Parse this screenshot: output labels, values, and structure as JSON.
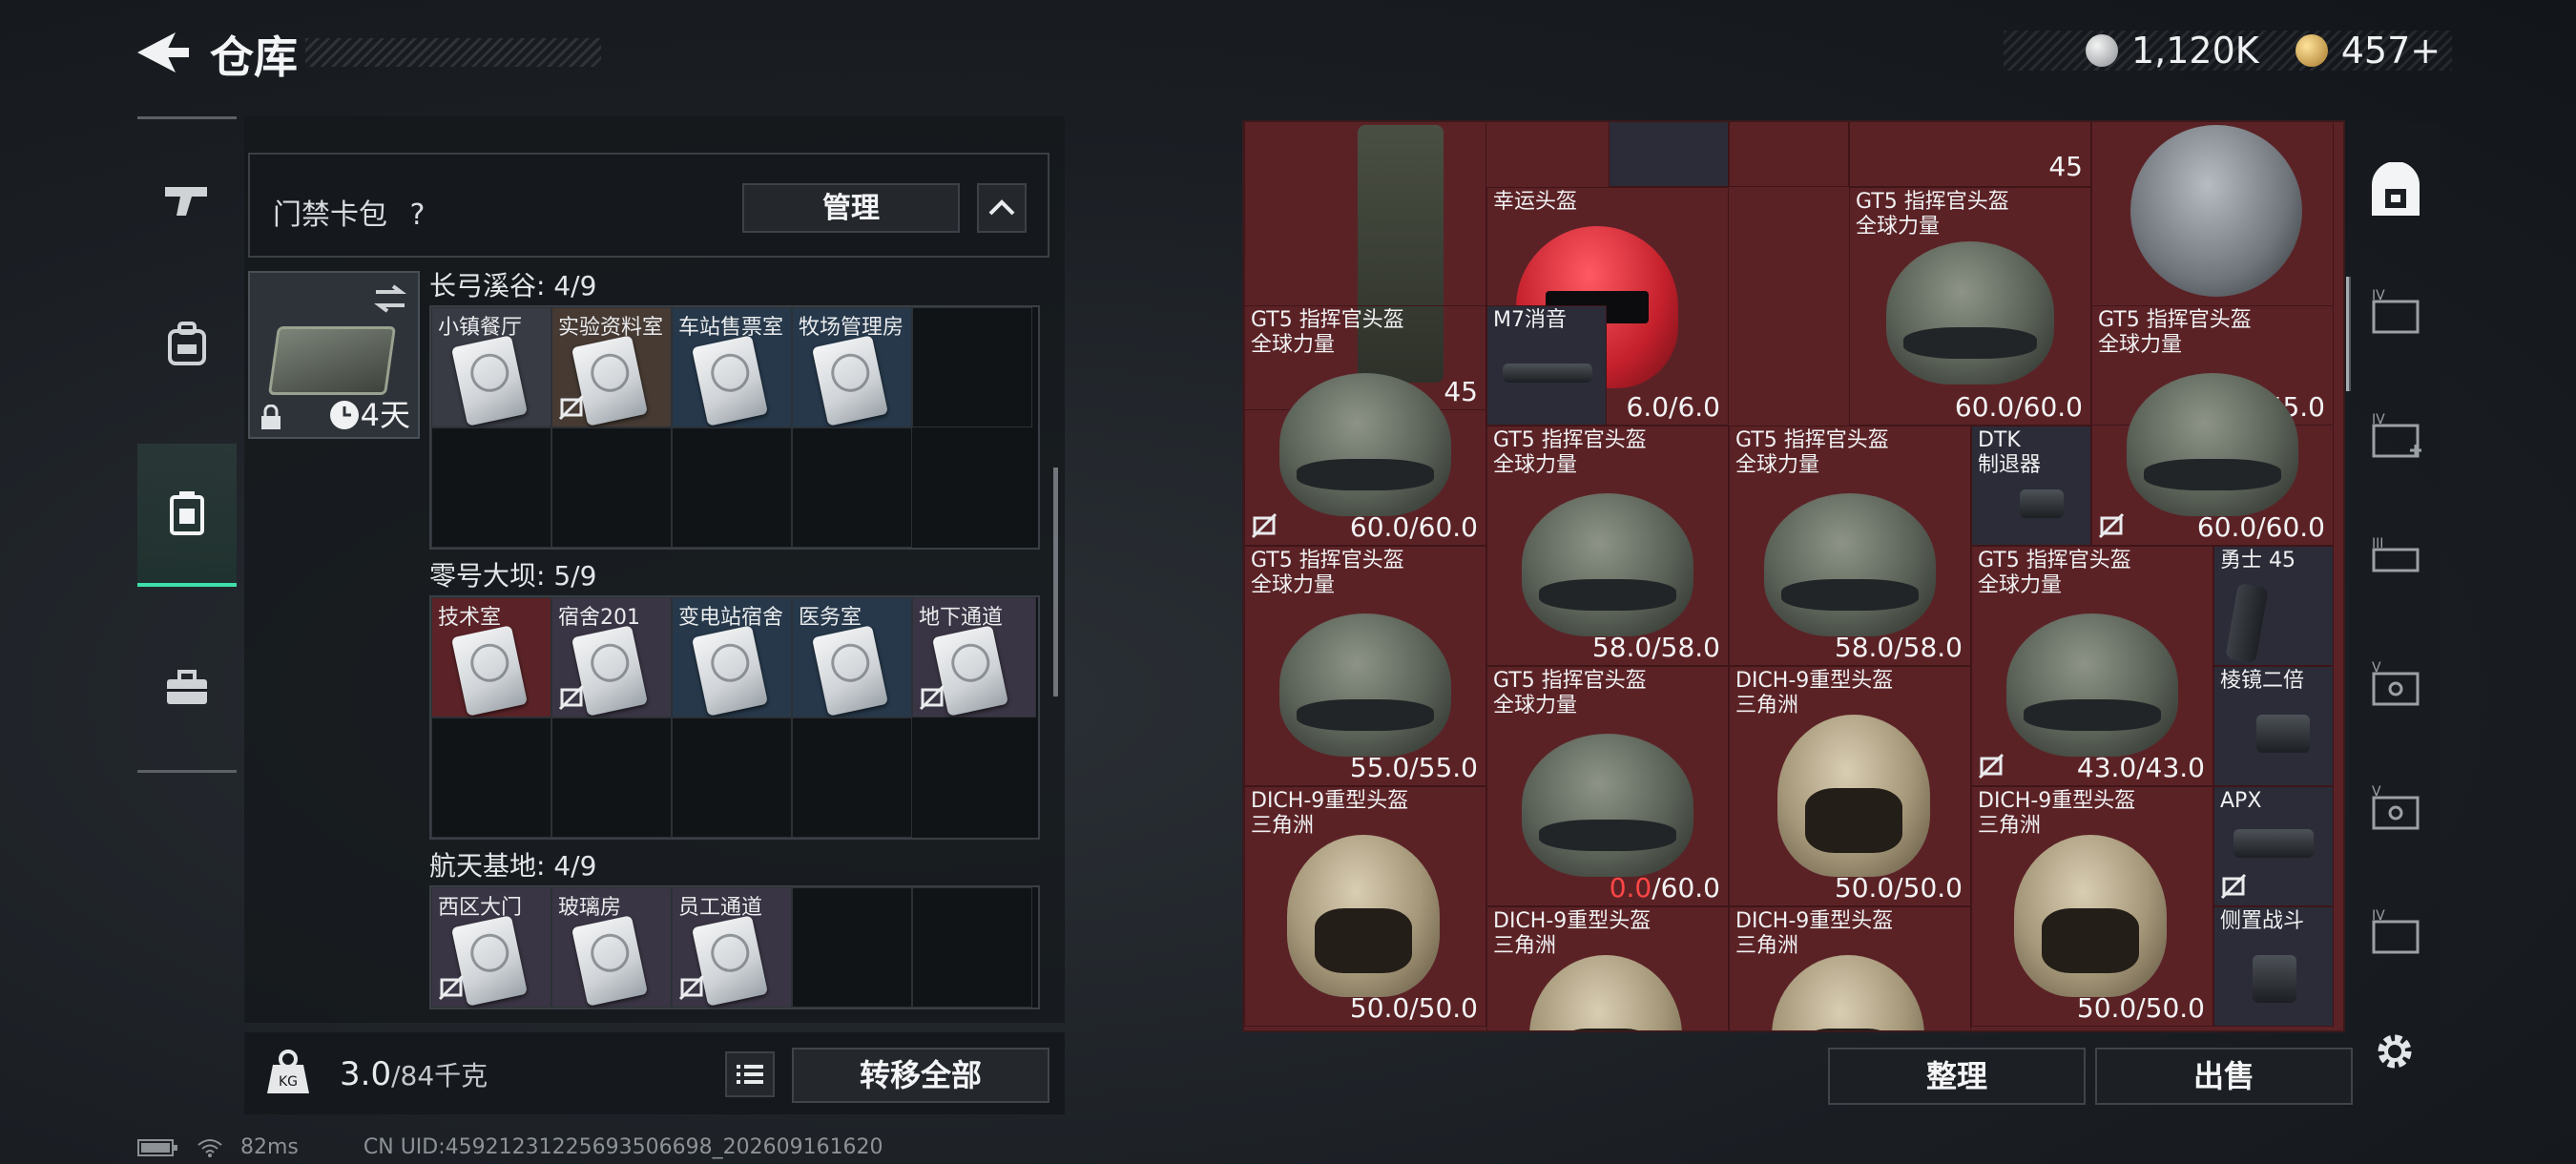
{
  "header": {
    "title": "仓库"
  },
  "currency": {
    "coins": "1,120K",
    "gems": "457+"
  },
  "left_panel": {
    "card_bag_label": "门禁卡包",
    "help": "?",
    "manage_label": "管理",
    "keybag_days": "4天",
    "sections": [
      {
        "title": "长弓溪谷: 4/9",
        "cards": [
          "小镇餐厅",
          "实验资料室",
          "车站售票室",
          "牧场管理房"
        ]
      },
      {
        "title": "零号大坝: 5/9",
        "cards": [
          "技术室",
          "宿舍201",
          "变电站宿舍",
          "医务室",
          "地下通道"
        ]
      },
      {
        "title": "航天基地: 4/9",
        "cards": [
          "西区大门",
          "玻璃房",
          "员工通道"
        ]
      }
    ],
    "weight_value": "3.0",
    "weight_unit": "/84千克",
    "transfer_label": "转移全部"
  },
  "stash": {
    "items": [
      {
        "count": "45"
      },
      {
        "count": "45"
      },
      {
        "name": "幸运头盔",
        "dura": "6.0/6.0"
      },
      {
        "name": "GT5 指挥官头盔\n全球力量",
        "dura": "60.0/60.0"
      },
      {
        "dura": "55.0/55.0"
      },
      {
        "name": "GT5 指挥官头盔\n全球力量",
        "dura": "60.0/60.0"
      },
      {
        "name": "M7消音"
      },
      {
        "name": "GT5 指挥官头盔\n全球力量",
        "dura": "60.0/60.0"
      },
      {
        "name": "GT5 指挥官头盔\n全球力量",
        "dura": "58.0/58.0"
      },
      {
        "name": "GT5 指挥官头盔\n全球力量",
        "dura": "58.0/58.0"
      },
      {
        "name": "DTK\n制退器"
      },
      {
        "name": "GT5 指挥官头盔\n全球力量",
        "dura": "55.0/55.0"
      },
      {
        "name": "GT5 指挥官头盔\n全球力量",
        "dura": "43.0/43.0"
      },
      {
        "name": "勇士 45"
      },
      {
        "name": "GT5 指挥官头盔\n全球力量",
        "dura_bad": "0.0",
        "dura_max": "/60.0"
      },
      {
        "name": "DICH-9重型头盔\n三角洲",
        "dura": "50.0/50.0"
      },
      {
        "name": "棱镜二倍"
      },
      {
        "name": "DICH-9重型头盔\n三角洲",
        "dura": "50.0/50.0"
      },
      {
        "name": "DICH-9重型头盔\n三角洲",
        "dura": "50.0/50.0"
      },
      {
        "name": "APX"
      },
      {
        "name": "DICH-9重型头盔\n三角洲"
      },
      {
        "name": "DICH-9重型头盔\n三角洲"
      },
      {
        "name": "侧置战斗"
      }
    ],
    "sort_label": "整理",
    "sell_label": "出售"
  },
  "status": {
    "ping": "82ms",
    "uid": "CN UID:459212312256935066​98_202609161620"
  },
  "colors": {
    "accent": "#3fe0a9",
    "stash_bg": "#5b2226",
    "durability_bad": "#ff4646"
  },
  "icons": [
    "back-arrow-icon",
    "gun-icon",
    "backpack-icon",
    "case-icon",
    "toolbox-icon",
    "lock-icon",
    "clock-icon",
    "swap-icon",
    "no-trade-icon",
    "weight-icon",
    "list-icon",
    "wifi-icon",
    "battery-icon",
    "settings-gear-icon",
    "safe-box-icon"
  ]
}
